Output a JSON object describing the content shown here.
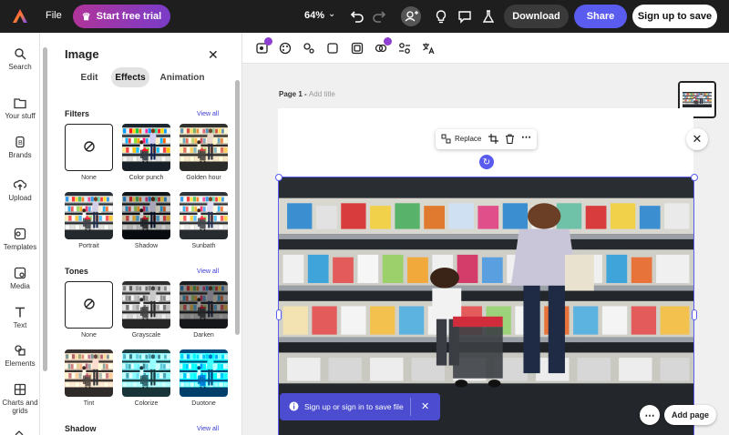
{
  "topbar": {
    "file_label": "File",
    "trial_label": "Start free trial",
    "zoom": "64%",
    "download_label": "Download",
    "share_label": "Share",
    "signup_label": "Sign up to save"
  },
  "rail": {
    "items": [
      {
        "label": "Search",
        "icon": "search-icon"
      },
      {
        "label": "Your stuff",
        "icon": "folder-icon"
      },
      {
        "label": "Brands",
        "icon": "brand-icon"
      },
      {
        "label": "Upload",
        "icon": "upload-icon"
      },
      {
        "label": "Templates",
        "icon": "templates-icon"
      },
      {
        "label": "Media",
        "icon": "media-icon"
      },
      {
        "label": "Text",
        "icon": "text-icon"
      },
      {
        "label": "Elements",
        "icon": "elements-icon"
      },
      {
        "label": "Charts and",
        "label2": "grids",
        "icon": "chart-icon"
      }
    ]
  },
  "panel": {
    "title": "Image",
    "tabs": [
      {
        "label": "Edit"
      },
      {
        "label": "Effects"
      },
      {
        "label": "Animation"
      }
    ],
    "filters": {
      "title": "Filters",
      "view_all": "View all",
      "items": [
        "None",
        "Color punch",
        "Golden hour",
        "Portrait",
        "Shadow",
        "Sunbath"
      ]
    },
    "tones": {
      "title": "Tones",
      "view_all": "View all",
      "items": [
        "None",
        "Grayscale",
        "Darken",
        "Tint",
        "Colorize",
        "Duotone"
      ]
    },
    "shadow": {
      "title": "Shadow",
      "view_all": "View all"
    }
  },
  "canvas": {
    "page_label": "Page 1 - ",
    "add_title": "Add title",
    "replace_label": "Replace",
    "toast_text": "Sign up or sign in to save file",
    "add_page_label": "Add page"
  },
  "colors": {
    "accent": "#5a5cf0",
    "trial_gradient_start": "#b0349a",
    "trial_gradient_end": "#7a3cc8",
    "toast_bg": "#4b4ccf"
  }
}
